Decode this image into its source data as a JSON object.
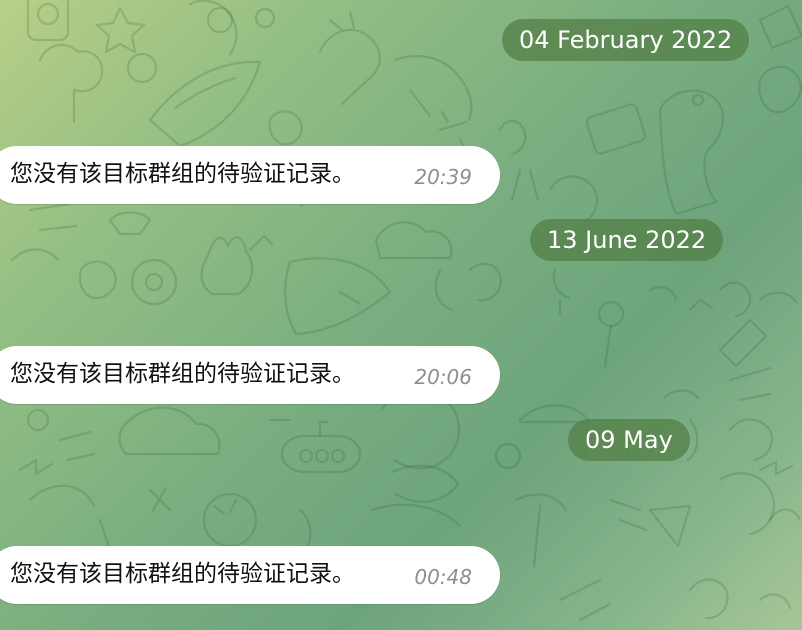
{
  "chat": {
    "messages": [
      {
        "date": "04 February 2022",
        "text": "您没有该目标群组的待验证记录。",
        "time": "20:39"
      },
      {
        "date": "13 June 2022",
        "text": "您没有该目标群组的待验证记录。",
        "time": "20:06"
      },
      {
        "date": "09 May",
        "text": "您没有该目标群组的待验证记录。",
        "time": "00:48"
      }
    ]
  },
  "colors": {
    "bubble": "#ffffff",
    "date_pill": "#548048",
    "time_text": "#8e8e93",
    "message_text": "#111111"
  }
}
